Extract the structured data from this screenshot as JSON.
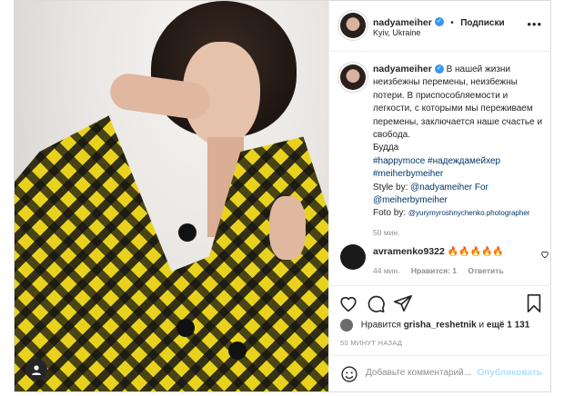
{
  "post": {
    "username": "nadyameiher",
    "follow_label": "Подписки",
    "dot_separator": "•",
    "location": "Kyiv, Ukraine",
    "more_label": "•••"
  },
  "caption": {
    "username": "nadyameiher",
    "text_line1": "В нашей жизни неизбежны перемены, неизбежны потери. В приспособляемости и легкости, с которыми мы переживаем перемены, заключается наше счастье и свобода.",
    "author": "Будда",
    "hashtags_line": "#happymoce #надеждамейхер",
    "hashtag2": "#meiherbymeiher",
    "style_by_prefix": "Style by: ",
    "style_by_handle": "@nadyameiher For",
    "style_by_handle2": "@meiherbymeiher",
    "foto_by_prefix": "Foto by: ",
    "foto_by_handle": "@yurymyroshnychenko.photographer",
    "time": "50 мин."
  },
  "comment": {
    "username": "avramenko9322",
    "text": "🔥🔥🔥🔥🔥",
    "time": "44 мин.",
    "likes": "Нравится: 1",
    "reply": "Ответить"
  },
  "likes": {
    "prefix": "Нравится",
    "user": "grisha_reshetnik",
    "and": "и",
    "others": "ещё 1 131"
  },
  "timestamp": "50 МИНУТ НАЗАД",
  "add_comment": {
    "placeholder": "Добавьте комментарий...",
    "publish": "Опубликовать"
  },
  "colors": {
    "link": "#00376b",
    "verified": "#3897f0",
    "publish_disabled": "#b2dffc",
    "coat_yellow": "#e8d21d"
  }
}
